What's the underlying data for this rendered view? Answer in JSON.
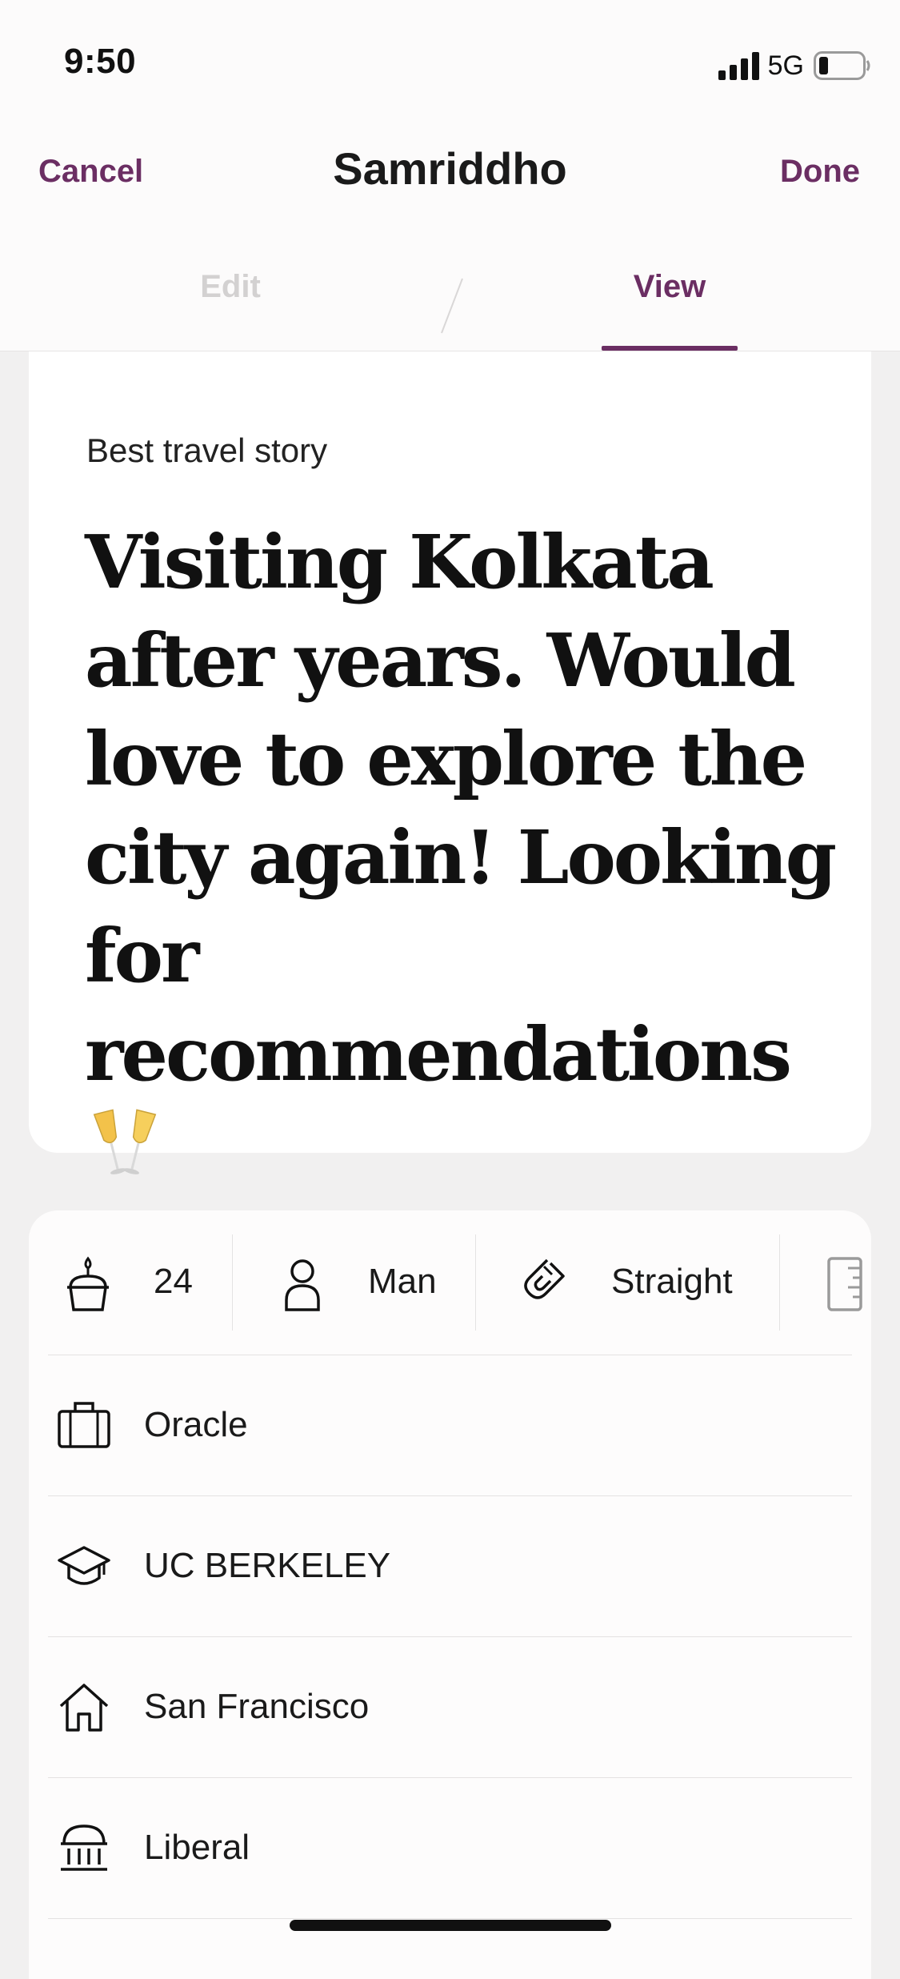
{
  "status_bar": {
    "time": "9:50",
    "network": "5G",
    "icons": [
      "signal-bars-icon",
      "battery-icon"
    ]
  },
  "nav": {
    "cancel_label": "Cancel",
    "title": "Samriddho",
    "done_label": "Done"
  },
  "tabs": {
    "edit_label": "Edit",
    "view_label": "View",
    "active": "View"
  },
  "prompt": {
    "question": "Best travel story",
    "answer": "Visiting Kolkata after years. Would love to explore the city again! Looking for recommendations",
    "emoji": "champagne-glasses-icon"
  },
  "vitals": {
    "age": "24",
    "gender": "Man",
    "sexuality": "Straight",
    "icons": [
      "birthday-cake-icon",
      "person-icon",
      "magnet-icon",
      "ruler-icon"
    ]
  },
  "details": {
    "work": "Oracle",
    "school": "UC BERKELEY",
    "hometown": "San Francisco",
    "politics": "Liberal"
  },
  "colors": {
    "accent": "#6b2e63",
    "inactive_tab": "#d3d1d1",
    "page_bg": "#f1f0f0",
    "card_bg": "#ffffff"
  }
}
